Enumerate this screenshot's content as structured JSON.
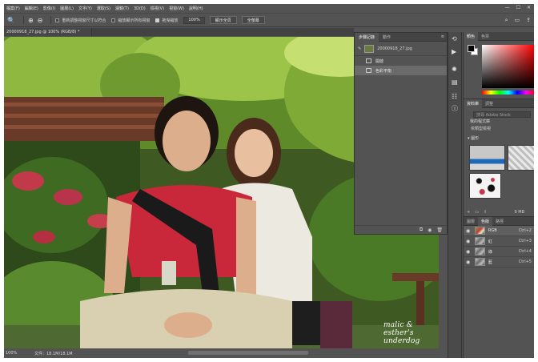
{
  "menu": [
    "檔案(F)",
    "編輯(E)",
    "影像(I)",
    "圖層(L)",
    "文字(Y)",
    "選取(S)",
    "濾鏡(T)",
    "3D(D)",
    "檢視(V)",
    "視窗(W)",
    "說明(H)"
  ],
  "window_controls": [
    "—",
    "☐",
    "✕"
  ],
  "options": {
    "check_resize": "重新調整視窗尺寸以符合",
    "check_all_windows": "縮放顯示所有視窗",
    "check_scrubby": "拖曳縮放",
    "zoom_value": "100%",
    "fit_button": "顯示全頁",
    "fill_button": "全螢幕"
  },
  "document": {
    "tab_title": "20000918_27.jpg @ 100% (RGB/8) *",
    "watermark": "malic & esther's underdog",
    "status_zoom": "100%",
    "status_doc": "文件：18.1M/18.1M"
  },
  "history_panel": {
    "tabs": [
      "步驟記錄",
      "動作"
    ],
    "snapshot": "20000918_27.jpg",
    "items": [
      "開啟",
      "色彩平衡"
    ]
  },
  "color_panel": {
    "tabs": [
      "顏色",
      "色票"
    ],
    "fg": "#000000",
    "bg": "#ffffff"
  },
  "libraries_panel": {
    "tabs": [
      "資料庫",
      "調整"
    ],
    "search_placeholder": "搜尋 Adobe Stock",
    "library_name": "我的程式庫",
    "view_mode": "依類型檢視",
    "section": "▾ 圖形",
    "size": "9 MB"
  },
  "channels_panel": {
    "tabs": [
      "圖層",
      "色版",
      "路徑"
    ],
    "rows": [
      {
        "name": "RGB",
        "key": "Ctrl+2"
      },
      {
        "name": "紅",
        "key": "Ctrl+3"
      },
      {
        "name": "綠",
        "key": "Ctrl+4"
      },
      {
        "name": "藍",
        "key": "Ctrl+5"
      }
    ]
  }
}
